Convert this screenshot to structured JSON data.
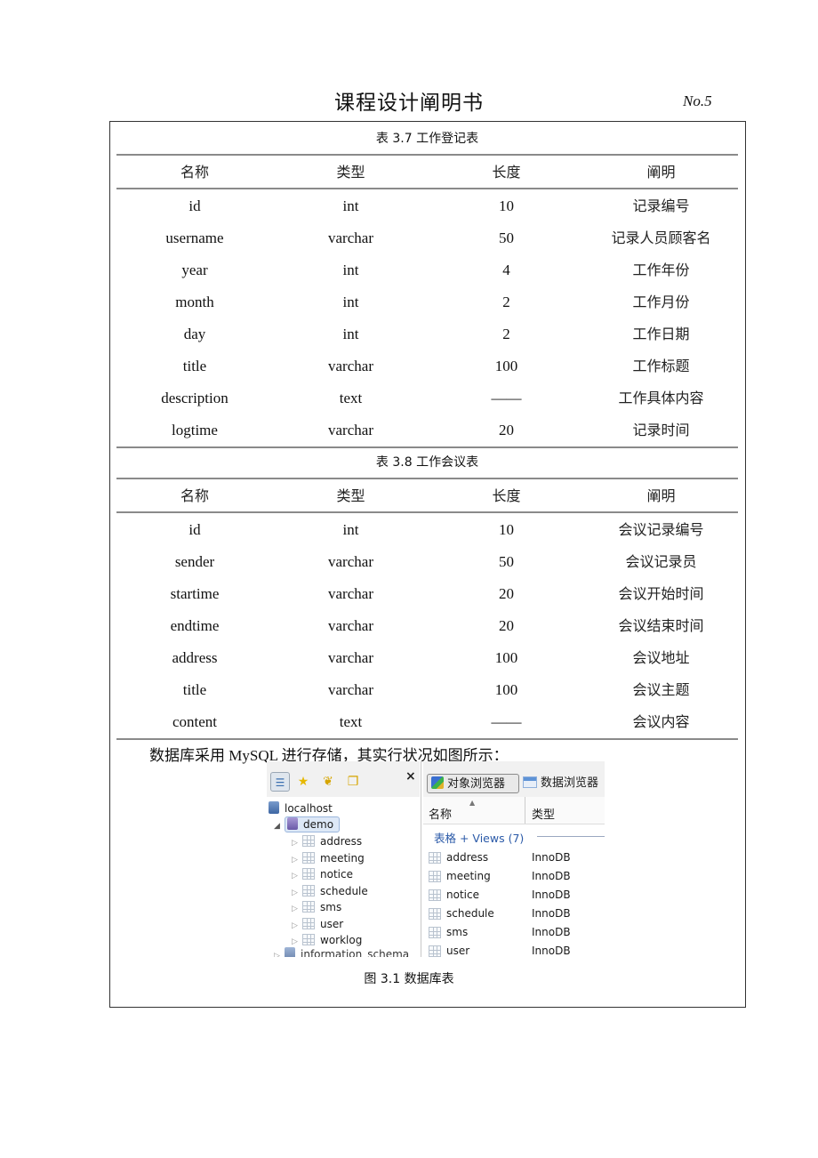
{
  "header": {
    "title": "课程设计阐明书",
    "page_number": "No.5"
  },
  "tables": [
    {
      "caption": "表 3.7  工作登记表",
      "columns": [
        "名称",
        "类型",
        "长度",
        "阐明"
      ],
      "rows": [
        [
          "id",
          "int",
          "10",
          "记录编号"
        ],
        [
          "username",
          "varchar",
          "50",
          "记录人员顾客名"
        ],
        [
          "year",
          "int",
          "4",
          "工作年份"
        ],
        [
          "month",
          "int",
          "2",
          "工作月份"
        ],
        [
          "day",
          "int",
          "2",
          "工作日期"
        ],
        [
          "title",
          "varchar",
          "100",
          "工作标题"
        ],
        [
          "description",
          "text",
          "——",
          "工作具体内容"
        ],
        [
          "logtime",
          "varchar",
          "20",
          "记录时间"
        ]
      ]
    },
    {
      "caption": "表 3.8  工作会议表",
      "columns": [
        "名称",
        "类型",
        "长度",
        "阐明"
      ],
      "rows": [
        [
          "id",
          "int",
          "10",
          "会议记录编号"
        ],
        [
          "sender",
          "varchar",
          "50",
          "会议记录员"
        ],
        [
          "startime",
          "varchar",
          "20",
          "会议开始时间"
        ],
        [
          "endtime",
          "varchar",
          "20",
          "会议结束时间"
        ],
        [
          "address",
          "varchar",
          "100",
          "会议地址"
        ],
        [
          "title",
          "varchar",
          "100",
          "会议主题"
        ],
        [
          "content",
          "text",
          "——",
          "会议内容"
        ]
      ]
    }
  ],
  "paragraph": "数据库采用 MySQL 进行存储，其实行状况如图所示：",
  "screenshot": {
    "left_toolbar_icons": [
      "tree-view-icon",
      "star-icon",
      "footprints-icon",
      "folders-icon"
    ],
    "close_label": "×",
    "tree": {
      "server": "localhost",
      "database": "demo",
      "tables": [
        "address",
        "meeting",
        "notice",
        "schedule",
        "sms",
        "user",
        "worklog"
      ],
      "next_database_partial": "information_schema"
    },
    "right_tabs": [
      "对象浏览器",
      "数据浏览器"
    ],
    "columns": [
      "名称",
      "类型"
    ],
    "group_header": "表格 + Views (7)",
    "rows": [
      {
        "name": "address",
        "engine": "InnoDB"
      },
      {
        "name": "meeting",
        "engine": "InnoDB"
      },
      {
        "name": "notice",
        "engine": "InnoDB"
      },
      {
        "name": "schedule",
        "engine": "InnoDB"
      },
      {
        "name": "sms",
        "engine": "InnoDB"
      },
      {
        "name": "user",
        "engine": "InnoDB"
      }
    ]
  },
  "figure_caption": "图 3.1  数据库表"
}
